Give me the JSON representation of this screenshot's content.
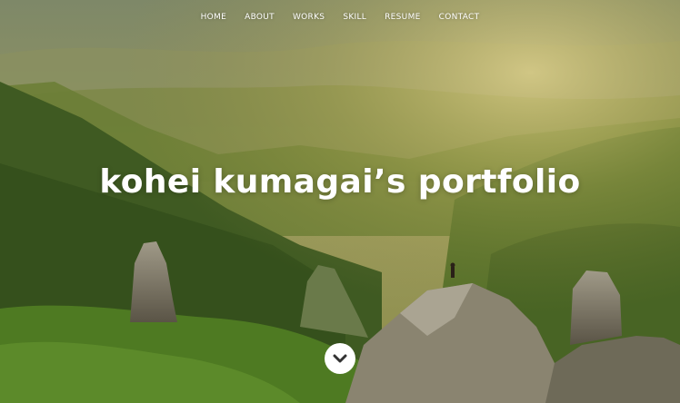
{
  "nav": {
    "items": [
      {
        "label": "HOME"
      },
      {
        "label": "ABOUT"
      },
      {
        "label": "WORKS"
      },
      {
        "label": "SKILL"
      },
      {
        "label": "RESUME"
      },
      {
        "label": "CONTACT"
      }
    ]
  },
  "hero": {
    "title": "kohei kumagai’s portfolio",
    "scroll_icon": "chevron-down-icon"
  },
  "colors": {
    "text": "#ffffff",
    "button_bg": "#ffffff",
    "chevron": "#333333"
  }
}
